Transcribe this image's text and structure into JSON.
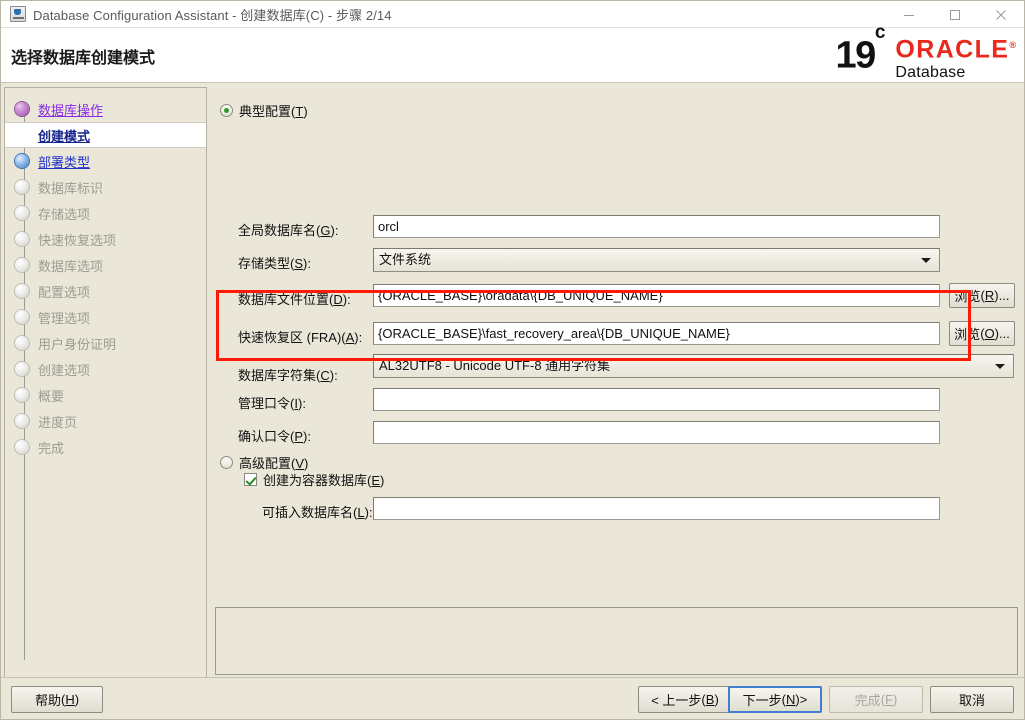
{
  "window": {
    "title": "Database Configuration Assistant - 创建数据库(C) - 步骤 2/14",
    "icon": "java-app-icon",
    "minimize_label": "—",
    "maximize_label": "□",
    "close_label": "✕"
  },
  "header": {
    "page_title": "选择数据库创建模式",
    "brand": {
      "version": "19",
      "version_sup": "c",
      "product": "ORACLE",
      "trademark": "®",
      "subtitle": "Database"
    }
  },
  "sidebar": {
    "items": [
      {
        "label": "数据库操作",
        "state": "visited"
      },
      {
        "label": "创建模式",
        "state": "current"
      },
      {
        "label": "部署类型",
        "state": "next"
      },
      {
        "label": "数据库标识",
        "state": "disabled"
      },
      {
        "label": "存储选项",
        "state": "disabled"
      },
      {
        "label": "快速恢复选项",
        "state": "disabled"
      },
      {
        "label": "数据库选项",
        "state": "disabled"
      },
      {
        "label": "配置选项",
        "state": "disabled"
      },
      {
        "label": "管理选项",
        "state": "disabled"
      },
      {
        "label": "用户身份证明",
        "state": "disabled"
      },
      {
        "label": "创建选项",
        "state": "disabled"
      },
      {
        "label": "概要",
        "state": "disabled"
      },
      {
        "label": "进度页",
        "state": "disabled"
      },
      {
        "label": "完成",
        "state": "disabled"
      }
    ]
  },
  "main": {
    "typical_radio": {
      "label": "典型配置",
      "mnemonic": "T",
      "selected": true
    },
    "advanced_radio": {
      "label": "高级配置",
      "mnemonic": "V",
      "selected": false
    },
    "fields": {
      "global_db_name": {
        "label": "全局数据库名",
        "mnemonic": "G",
        "value": "orcl"
      },
      "storage_type": {
        "label": "存储类型",
        "mnemonic": "S",
        "value": "文件系统"
      },
      "db_file_location": {
        "label": "数据库文件位置",
        "mnemonic": "D",
        "value": "{ORACLE_BASE}\\oradata\\{DB_UNIQUE_NAME}",
        "browse_label": "浏览",
        "browse_mnemonic": "R"
      },
      "fra": {
        "label": "快速恢复区 (FRA)",
        "mnemonic": "A",
        "value": "{ORACLE_BASE}\\fast_recovery_area\\{DB_UNIQUE_NAME}",
        "browse_label": "浏览",
        "browse_mnemonic": "O"
      },
      "charset": {
        "label": "数据库字符集",
        "mnemonic": "C",
        "value": "AL32UTF8 - Unicode UTF-8 通用字符集"
      },
      "admin_password": {
        "label": "管理口令",
        "mnemonic": "I",
        "value": ""
      },
      "confirm_password": {
        "label": "确认口令",
        "mnemonic": "P",
        "value": ""
      },
      "pdb_name": {
        "label": "可插入数据库名",
        "mnemonic": "L",
        "value": ""
      }
    },
    "container_checkbox": {
      "label": "创建为容器数据库",
      "mnemonic": "E",
      "checked": true
    },
    "highlight_color": "#FF1A05"
  },
  "footer": {
    "help": {
      "label": "帮助",
      "mnemonic": "H",
      "disabled": false
    },
    "back": {
      "label": "< 上一步",
      "mnemonic": "B",
      "disabled": false
    },
    "next": {
      "label": "下一步",
      "mnemonic": "N",
      "suffix": " >",
      "disabled": false,
      "focused": true
    },
    "finish": {
      "label": "完成",
      "mnemonic": "F",
      "disabled": true
    },
    "cancel": {
      "label": "取消",
      "disabled": false
    }
  }
}
